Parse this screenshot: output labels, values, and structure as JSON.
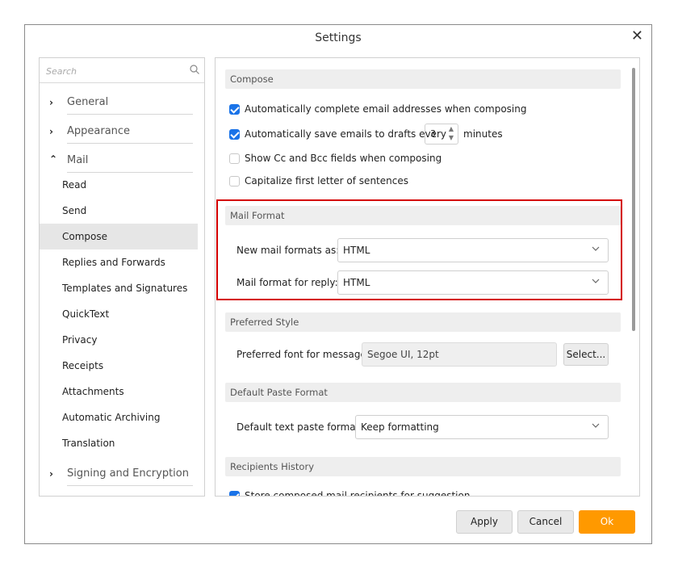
{
  "window": {
    "title": "Settings"
  },
  "sidebar": {
    "search_placeholder": "Search",
    "categories": [
      {
        "label": "General",
        "expanded": false
      },
      {
        "label": "Appearance",
        "expanded": false
      },
      {
        "label": "Mail",
        "expanded": true
      },
      {
        "label": "Signing and Encryption",
        "expanded": false
      }
    ],
    "mail_items": [
      "Read",
      "Send",
      "Compose",
      "Replies and Forwards",
      "Templates and Signatures",
      "QuickText",
      "Privacy",
      "Receipts",
      "Attachments",
      "Automatic Archiving",
      "Translation"
    ],
    "active_item": "Compose"
  },
  "compose": {
    "section_title": "Compose",
    "options": [
      {
        "label": "Automatically complete email addresses when composing",
        "checked": true
      },
      {
        "label": "Automatically save emails to drafts every",
        "checked": true
      },
      {
        "label": "Show Cc and Bcc fields when composing",
        "checked": false
      },
      {
        "label": "Capitalize first letter of sentences",
        "checked": false
      }
    ],
    "draft_interval": "3",
    "draft_interval_unit": "minutes"
  },
  "mail_format": {
    "section_title": "Mail Format",
    "new_mail_label": "New mail formats as:",
    "new_mail_value": "HTML",
    "reply_label": "Mail format for reply:",
    "reply_value": "HTML"
  },
  "preferred_style": {
    "section_title": "Preferred Style",
    "font_label": "Preferred font for messages:",
    "font_value": "Segoe UI, 12pt",
    "select_button": "Select..."
  },
  "paste_format": {
    "section_title": "Default Paste Format",
    "label": "Default text paste format:",
    "value": "Keep formatting"
  },
  "recipients_history": {
    "section_title": "Recipients History",
    "option_label": "Store composed mail recipients for suggestion",
    "checked": true
  },
  "footer": {
    "apply": "Apply",
    "cancel": "Cancel",
    "ok": "Ok"
  },
  "colors": {
    "accent": "#1a73e8",
    "ok_button": "#ff9900",
    "highlight": "#d40000"
  }
}
